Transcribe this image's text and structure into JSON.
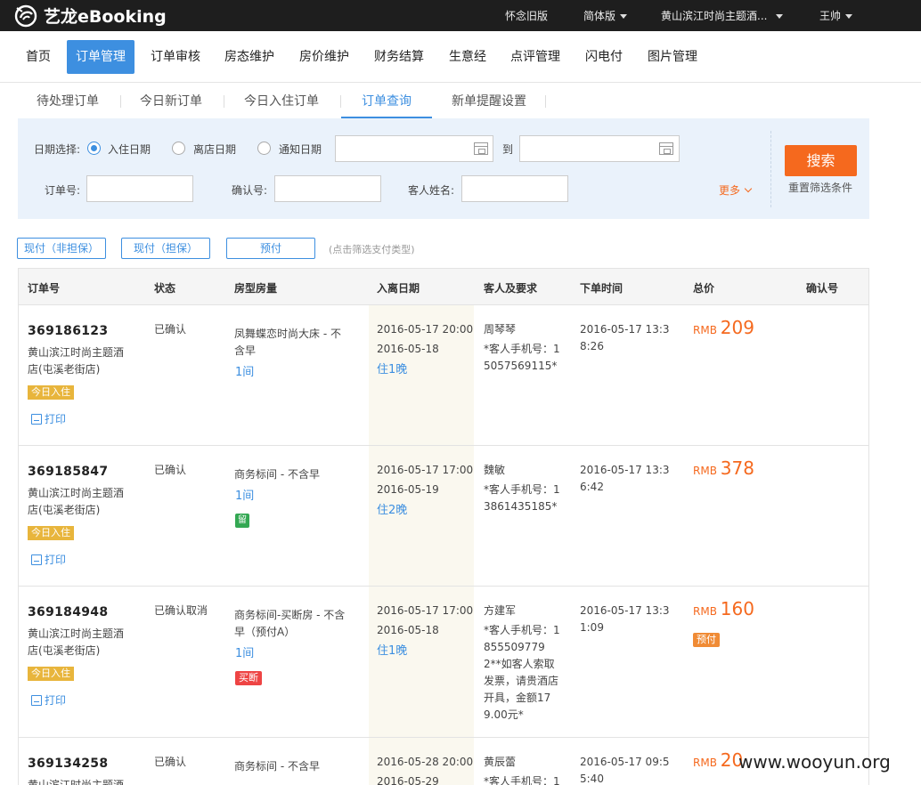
{
  "brand": {
    "logo_text": "艺龙eBooking"
  },
  "topbar": {
    "old_version": "怀念旧版",
    "language": "简体版",
    "hotel": "黄山滨江时尚主题酒...",
    "user": "王帅"
  },
  "nav": {
    "items": [
      "首页",
      "订单管理",
      "订单审核",
      "房态维护",
      "房价维护",
      "财务结算",
      "生意经",
      "点评管理",
      "闪电付",
      "图片管理"
    ],
    "active_index": 1
  },
  "subtabs": {
    "items": [
      "待处理订单",
      "今日新订单",
      "今日入住订单",
      "订单查询",
      "新单提醒设置"
    ],
    "active_index": 3
  },
  "search": {
    "date_select_label": "日期选择:",
    "radio_checkin": "入住日期",
    "radio_checkout": "离店日期",
    "radio_notify": "通知日期",
    "date_to": "到",
    "order_no_label": "订单号:",
    "confirm_no_label": "确认号:",
    "guest_name_label": "客人姓名:",
    "more": "更多",
    "search_button": "搜索",
    "reset": "重置筛选条件"
  },
  "pay_filters": {
    "items": [
      "现付（非担保）",
      "现付（担保）",
      "预付"
    ],
    "hint": "(点击筛选支付类型)"
  },
  "table": {
    "headers": [
      "订单号",
      "状态",
      "房型房量",
      "入离日期",
      "客人及要求",
      "下单时间",
      "总价",
      "确认号"
    ],
    "print_label": "打印",
    "currency": "RMB",
    "rows": [
      {
        "order_no": "369186123",
        "hotel_line1": "黄山滨江时尚主题酒",
        "hotel_line2": "店(屯溪老街店)",
        "tag": "今日入住",
        "status": "已确认",
        "room_line1": "凤舞蝶恋时尚大床 - 不",
        "room_line2": "含早",
        "room_count": "1间",
        "checkin": "2016-05-17 20:00",
        "checkout": "2016-05-18",
        "nights": "住1晚",
        "guest": "周琴琴",
        "guest_lines": [
          "*客人手机号：1",
          "5057569115*"
        ],
        "order_time_line1": "2016-05-17 13:3",
        "order_time_line2": "8:26",
        "price": "209",
        "confirm_no": ""
      },
      {
        "order_no": "369185847",
        "hotel_line1": "黄山滨江时尚主题酒",
        "hotel_line2": "店(屯溪老街店)",
        "tag": "今日入住",
        "status": "已确认",
        "room_line1": "商务标间 - 不含早",
        "room_line2": "",
        "room_count": "1间",
        "room_badge": "留",
        "checkin": "2016-05-17 17:00",
        "checkout": "2016-05-19",
        "nights": "住2晚",
        "guest": "魏敏",
        "guest_lines": [
          "*客人手机号：1",
          "3861435185*"
        ],
        "order_time_line1": "2016-05-17 13:3",
        "order_time_line2": "6:42",
        "price": "378",
        "confirm_no": ""
      },
      {
        "order_no": "369184948",
        "hotel_line1": "黄山滨江时尚主题酒",
        "hotel_line2": "店(屯溪老街店)",
        "tag": "今日入住",
        "status": "已确认取消",
        "room_line1": "商务标间-买断房 - 不含",
        "room_line2": "早（预付A）",
        "room_count": "1间",
        "room_badge": "买断",
        "checkin": "2016-05-17 17:00",
        "checkout": "2016-05-18",
        "nights": "住1晚",
        "guest": "方建军",
        "guest_lines": [
          "*客人手机号：1",
          "855509779",
          "2**如客人索取",
          "发票，请贵酒店",
          "开具，金额17",
          "9.00元*"
        ],
        "order_time_line1": "2016-05-17 13:3",
        "order_time_line2": "1:09",
        "price": "160",
        "price_badge": "预付",
        "confirm_no": ""
      },
      {
        "order_no": "369134258",
        "hotel_line1": "黄山滨江时尚主题酒",
        "hotel_line2": "",
        "tag": "",
        "status": "已确认",
        "room_line1": "商务标间 - 不含早",
        "room_line2": "",
        "room_count": "",
        "checkin": "2016-05-28 20:00",
        "checkout": "2016-05-29",
        "nights": "",
        "guest": "黄辰蕾",
        "guest_lines": [
          "*客人手机号：1"
        ],
        "order_time_line1": "2016-05-17 09:5",
        "order_time_line2": "5:40",
        "price": "20",
        "confirm_no": ""
      }
    ]
  },
  "watermark": "www.wooyun.org"
}
